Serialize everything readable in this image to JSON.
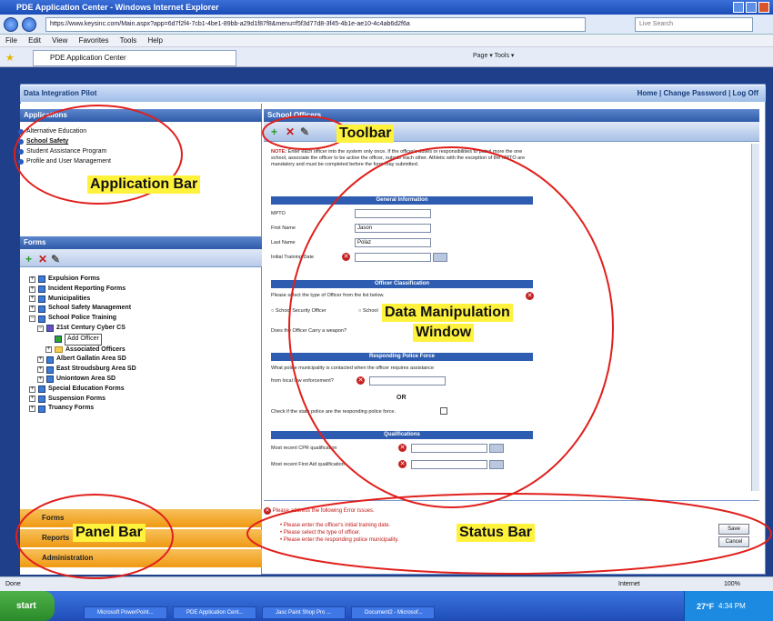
{
  "browser": {
    "title": "PDE Application Center - Windows Internet Explorer",
    "address": "https://www.keysinc.com/Main.aspx?app=6d7f2f4-7cb1-4be1-89bb-a29d1f87f8&menu=f5f3d77d8-3f45-4b1e-ae10-4c4ab6d2f6a",
    "search_placeholder": "Live Search",
    "menu": [
      "File",
      "Edit",
      "View",
      "Favorites",
      "Tools",
      "Help"
    ],
    "tab": "PDE Application Center",
    "commands": "Page ▾   Tools ▾",
    "status_left": "Done",
    "status_zone": "Internet",
    "zoom": "100%"
  },
  "app": {
    "name": "Data Integration Pilot",
    "links": "Home | Change Password | Log Off"
  },
  "applications_pane": {
    "title": "Applications",
    "items": [
      "Alternative Education",
      "School Safety",
      "Student Assistance Program",
      "Profile and User Management"
    ]
  },
  "forms_pane": {
    "title": "Forms",
    "tree": [
      {
        "label": "Expulsion Forms",
        "indent": 0,
        "kind": "form"
      },
      {
        "label": "Incident Reporting Forms",
        "indent": 0,
        "kind": "form"
      },
      {
        "label": "Municipalities",
        "indent": 0,
        "kind": "form"
      },
      {
        "label": "School Safety Management",
        "indent": 0,
        "kind": "form"
      },
      {
        "label": "School Police Training",
        "indent": 0,
        "kind": "form"
      },
      {
        "label": "21st Century Cyber CS",
        "indent": 1,
        "kind": "school"
      },
      {
        "label": "Add Officer",
        "indent": 2,
        "kind": "add"
      },
      {
        "label": "Associated Officers",
        "indent": 2,
        "kind": "folder"
      },
      {
        "label": "Albert Gallatin Area SD",
        "indent": 1,
        "kind": "form"
      },
      {
        "label": "East Stroudsburg Area SD",
        "indent": 1,
        "kind": "form"
      },
      {
        "label": "Uniontown Area SD",
        "indent": 1,
        "kind": "form"
      },
      {
        "label": "Special Education Forms",
        "indent": 0,
        "kind": "form"
      },
      {
        "label": "Suspension Forms",
        "indent": 0,
        "kind": "form"
      },
      {
        "label": "Truancy Forms",
        "indent": 0,
        "kind": "form"
      }
    ]
  },
  "panel_bar": {
    "items": [
      "Forms",
      "Reports",
      "Administration"
    ]
  },
  "main_pane": {
    "title": "School Officers",
    "note_label": "NOTE:",
    "note": "Enter each officer into the system only once. If the officer's duties or responsibilities to patrol more the one school, associate the officer to be active the officer, outside each other. Athletic with the exception of the MPTO are mandatory and must be completed before the form may submitted.",
    "sections": {
      "general": "General Information",
      "classification": "Officer Classification",
      "police": "Responding Police Force",
      "qualifications": "Qualifications"
    },
    "fields": {
      "mpto_label": "MPTO",
      "mpto_value": "",
      "first_name_label": "First Name",
      "first_name_value": "Jason",
      "last_name_label": "Last Name",
      "last_name_value": "Polaz",
      "training_date_label": "Initial Training Date",
      "classification_prompt": "Please select the type of Officer from the list below.",
      "option_security": "School Security Officer",
      "option_other": "School",
      "carry_weapon": "Does the Officer Carry a weapon?",
      "municipality_prompt": "What police municipality is contacted when the officer requires assistance",
      "local_law": "from local law enforcement?",
      "or_text": "OR",
      "state_police": "Check if the state police are the responding police force.",
      "cpr_label": "Most recent CPR qualification",
      "first_aid_label": "Most recent First Aid qualification"
    }
  },
  "status": {
    "heading": "Please address the following Error Issues.",
    "errors": [
      "Please enter the officer's initial training date.",
      "Please select the type of officer.",
      "Please enter the responding police municipality."
    ],
    "save_label": "Save",
    "cancel_label": "Cancel"
  },
  "annotations": {
    "toolbar": "Toolbar",
    "application_bar": "Application Bar",
    "data_window_1": "Data Manipulation",
    "data_window_2": "Window",
    "panel_bar": "Panel Bar",
    "status_bar": "Status Bar"
  },
  "taskbar": {
    "start": "start",
    "tasks": [
      "Microsoft PowerPoint...",
      "PDE Application Cent...",
      "Jasc Paint Shop Pro ...",
      "Document2 - Microsof..."
    ],
    "temperature": "27°F",
    "time": "4:34 PM"
  },
  "colors": {
    "annotation_highlight": "#fff23d",
    "annotation_ring": "#e0201c",
    "panel_bar_orange": "#f4a21e",
    "section_blue": "#2d5cb0",
    "error_red": "#c01818"
  },
  "icons": [
    "back-icon",
    "forward-icon",
    "add-icon",
    "delete-icon",
    "edit-icon",
    "error-icon",
    "calendar-icon",
    "folder-icon"
  ]
}
